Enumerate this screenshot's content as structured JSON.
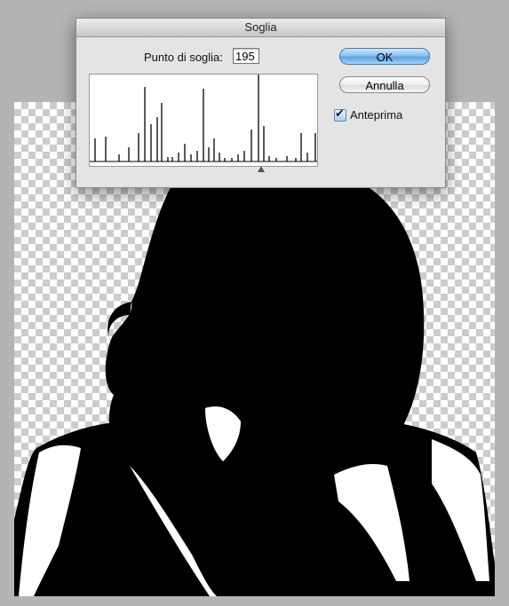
{
  "dialog": {
    "title": "Soglia",
    "threshold_label": "Punto di soglia:",
    "threshold_value": "195",
    "ok_label": "OK",
    "cancel_label": "Annulla",
    "preview_label": "Anteprima",
    "preview_checked": true
  },
  "colors": {
    "accent_button": "#5aa3e6",
    "dialog_bg": "#e4e4e4",
    "app_bg": "#b4b4b4"
  }
}
